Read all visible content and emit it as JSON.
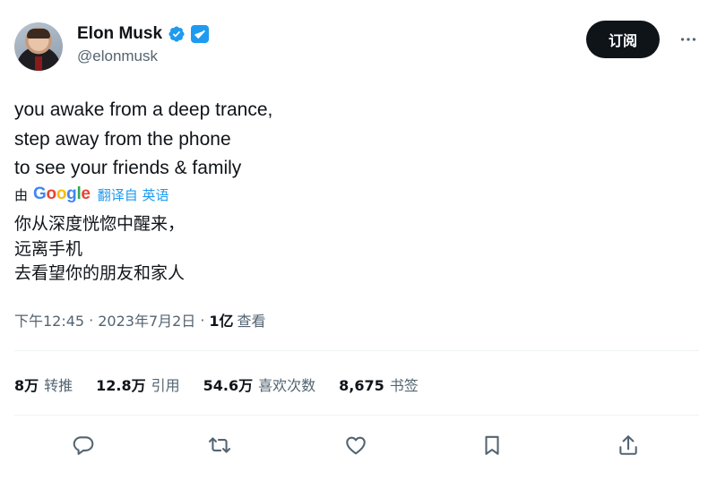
{
  "user": {
    "name": "Elon Musk",
    "handle": "@elonmusk"
  },
  "header": {
    "subscribe_label": "订阅",
    "more_icon": "more-horizontal-icon"
  },
  "tweet": {
    "lines": [
      "you awake from a deep trance,",
      "step away from the phone",
      "to see your friends & family"
    ],
    "translation": {
      "by_label": "由",
      "provider": "Google",
      "from_label": "翻译自 英语",
      "lines": [
        "你从深度恍惚中醒来，",
        "远离手机",
        "去看望你的朋友和家人"
      ]
    }
  },
  "meta": {
    "time": "下午12:45",
    "date": "2023年7月2日",
    "separator": "·",
    "views_count": "1亿",
    "views_label": "查看"
  },
  "stats": [
    {
      "count": "8万",
      "label": "转推"
    },
    {
      "count": "12.8万",
      "label": "引用"
    },
    {
      "count": "54.6万",
      "label": "喜欢次数"
    },
    {
      "count": "8,675",
      "label": "书签"
    }
  ],
  "actions": [
    "reply-icon",
    "retweet-icon",
    "like-icon",
    "bookmark-icon",
    "share-icon"
  ],
  "colors": {
    "accent": "#1d9bf0",
    "text": "#0f1419",
    "secondary": "#536471",
    "button_bg": "#0f1419"
  }
}
